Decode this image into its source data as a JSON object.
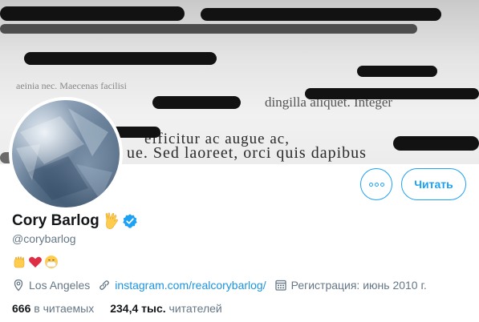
{
  "profile": {
    "name": "Cory Barlog",
    "handle": "@corybarlog",
    "location": "Los Angeles",
    "website": "instagram.com/realcorybarlog/",
    "joined": "Регистрация: июнь 2010 г."
  },
  "actions": {
    "follow_label": "Читать"
  },
  "stats": {
    "following_count": "666",
    "following_label": "в читаемых",
    "followers_count": "234,4 тыс.",
    "followers_label": "читателей"
  },
  "banner": {
    "line1": "efficitur ac augue ac,",
    "line2": "ue. Sed laoreet, orci quis dapibus",
    "faded1": "dingilla aliquet. Integer",
    "faded2": "aeinia nec. Maecenas facilisi"
  },
  "icons": {
    "accent": "#1da1f2",
    "verified": "verified-badge-icon",
    "hand": "vulcan-salute-icon",
    "bio_emojis": [
      "raised-fist-icon",
      "heart-icon",
      "mask-face-icon"
    ]
  }
}
